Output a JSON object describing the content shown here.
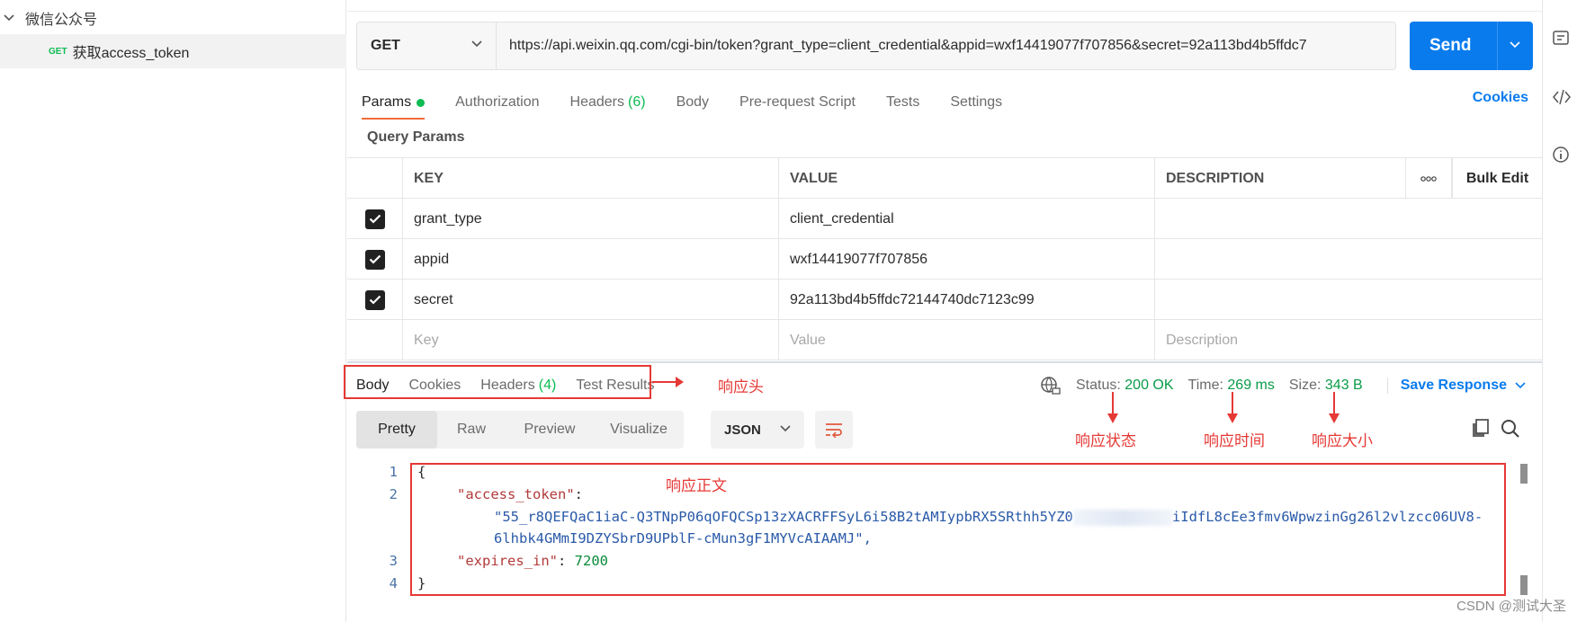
{
  "sidebar": {
    "collection_name": "微信公众号",
    "request": {
      "method": "GET",
      "name": "获取access_token"
    }
  },
  "request": {
    "method": "GET",
    "url": "https://api.weixin.qq.com/cgi-bin/token?grant_type=client_credential&appid=wxf14419077f707856&secret=92a113bd4b5ffdc7",
    "send_label": "Send",
    "tabs": [
      {
        "label": "Params"
      },
      {
        "label": "Authorization"
      },
      {
        "label": "Headers",
        "count": "(6)"
      },
      {
        "label": "Body"
      },
      {
        "label": "Pre-request Script"
      },
      {
        "label": "Tests"
      },
      {
        "label": "Settings"
      }
    ],
    "cookies_label": "Cookies",
    "query_params_title": "Query Params",
    "table": {
      "headers": {
        "key": "KEY",
        "value": "VALUE",
        "description": "DESCRIPTION",
        "bulk_edit": "Bulk Edit"
      },
      "rows": [
        {
          "key": "grant_type",
          "value": "client_credential"
        },
        {
          "key": "appid",
          "value": "wxf14419077f707856"
        },
        {
          "key": "secret",
          "value": "92a113bd4b5ffdc72144740dc7123c99"
        }
      ],
      "placeholders": {
        "key": "Key",
        "value": "Value",
        "description": "Description"
      }
    }
  },
  "response": {
    "tabs": [
      {
        "label": "Body"
      },
      {
        "label": "Cookies"
      },
      {
        "label": "Headers",
        "count": "(4)"
      },
      {
        "label": "Test Results"
      }
    ],
    "status_label": "Status:",
    "status_value": "200 OK",
    "time_label": "Time:",
    "time_value": "269 ms",
    "size_label": "Size:",
    "size_value": "343 B",
    "save_label": "Save Response",
    "views": [
      "Pretty",
      "Raw",
      "Preview",
      "Visualize"
    ],
    "format": "JSON",
    "code": {
      "line_numbers": [
        "1",
        "2",
        "3",
        "4"
      ],
      "open_brace": "{",
      "key_access_token": "\"access_token\"",
      "token_part1": "\"55_r8QEFQaC1iaC-Q3TNpP06qOFQCSp13zXACRFFSyL6i58B2tAMIypbRX5SRthh5YZ0",
      "token_part2": "iIdfL8cEe3fmv6WpwzinGg26l2vlzcc06UV8-",
      "token_line2": "6lhbk4GMmI9DZYSbrD9UPblF-cMun3gF1MYVcAIAAMJ\",",
      "key_expires_in": "\"expires_in\"",
      "expires_value": "7200",
      "close_brace": "}"
    }
  },
  "annotations": {
    "headers": "响应头",
    "status": "响应状态",
    "time": "响应时间",
    "size": "响应大小",
    "body": "响应正文"
  },
  "watermark": "CSDN @测试大圣",
  "colors": {
    "accent": "#097bed",
    "annotation": "#e53935",
    "success": "#0cbb52",
    "active_tab": "#f26b3a"
  }
}
